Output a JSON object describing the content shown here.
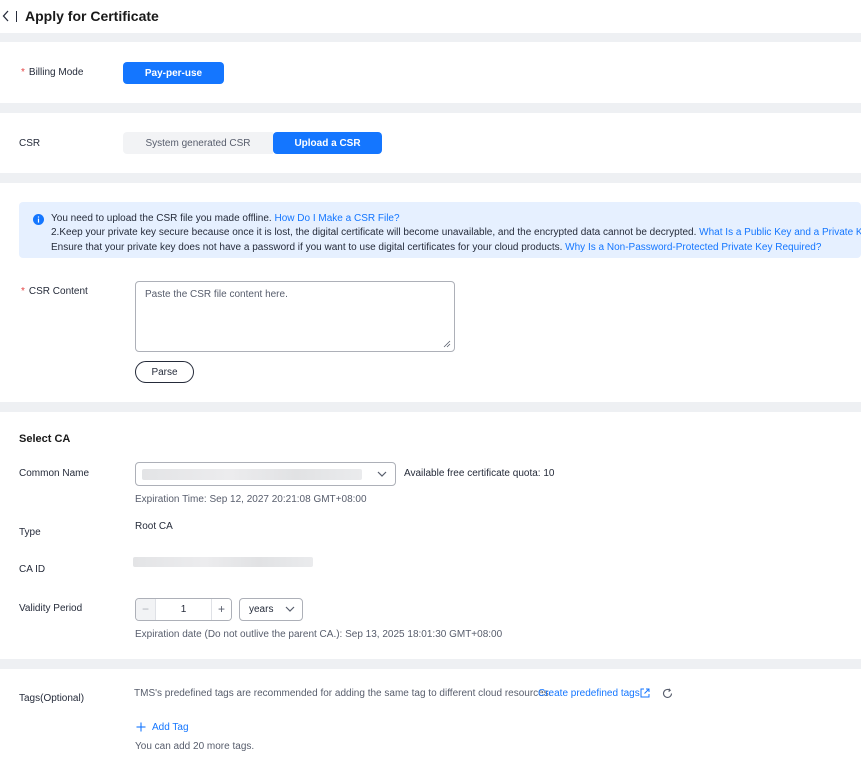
{
  "header": {
    "title": "Apply for Certificate"
  },
  "billing": {
    "label": "Billing Mode",
    "required_mark": "*",
    "option": "Pay-per-use"
  },
  "csr": {
    "label": "CSR",
    "options": [
      "System generated CSR",
      "Upload a CSR"
    ],
    "selected": "Upload a CSR"
  },
  "notice": {
    "line1_text": "You need to upload the CSR file you made offline.",
    "line1_link": "How Do I Make a CSR File?",
    "line2_text": "2.Keep your private key secure because once it is lost, the digital certificate will become unavailable, and the encrypted data cannot be decrypted.",
    "line2_link": "What Is a Public Key and a Private Key?",
    "line3_text": "Ensure that your private key does not have a password if you want to use digital certificates for your cloud products.",
    "line3_link": "Why Is a Non-Password-Protected Private Key Required?"
  },
  "csr_content": {
    "label": "CSR Content",
    "required_mark": "*",
    "placeholder": "Paste the CSR file content here.",
    "value": "",
    "parse_label": "Parse"
  },
  "select_ca": {
    "title": "Select CA",
    "common_name": {
      "label": "Common Name",
      "quota_text": "Available free certificate quota: 10",
      "expiration_text": "Expiration Time: Sep 12, 2027 20:21:08 GMT+08:00"
    },
    "type": {
      "label": "Type",
      "value": "Root CA"
    },
    "ca_id": {
      "label": "CA ID"
    },
    "validity": {
      "label": "Validity Period",
      "value": "1",
      "unit": "years",
      "expiration_text": "Expiration date (Do not outlive the parent CA.): Sep 13, 2025 18:01:30 GMT+08:00"
    }
  },
  "tags": {
    "label": "Tags(Optional)",
    "hint": "TMS's predefined tags are recommended for adding the same tag to different cloud resources.",
    "create_link": "Create predefined tags",
    "add_label": "Add Tag",
    "remaining_text": "You can add 20 more tags."
  },
  "colors": {
    "primary": "#1476ff",
    "required": "#e54545",
    "notice_bg": "#e6f0ff",
    "page_bg": "#eef0f3"
  }
}
